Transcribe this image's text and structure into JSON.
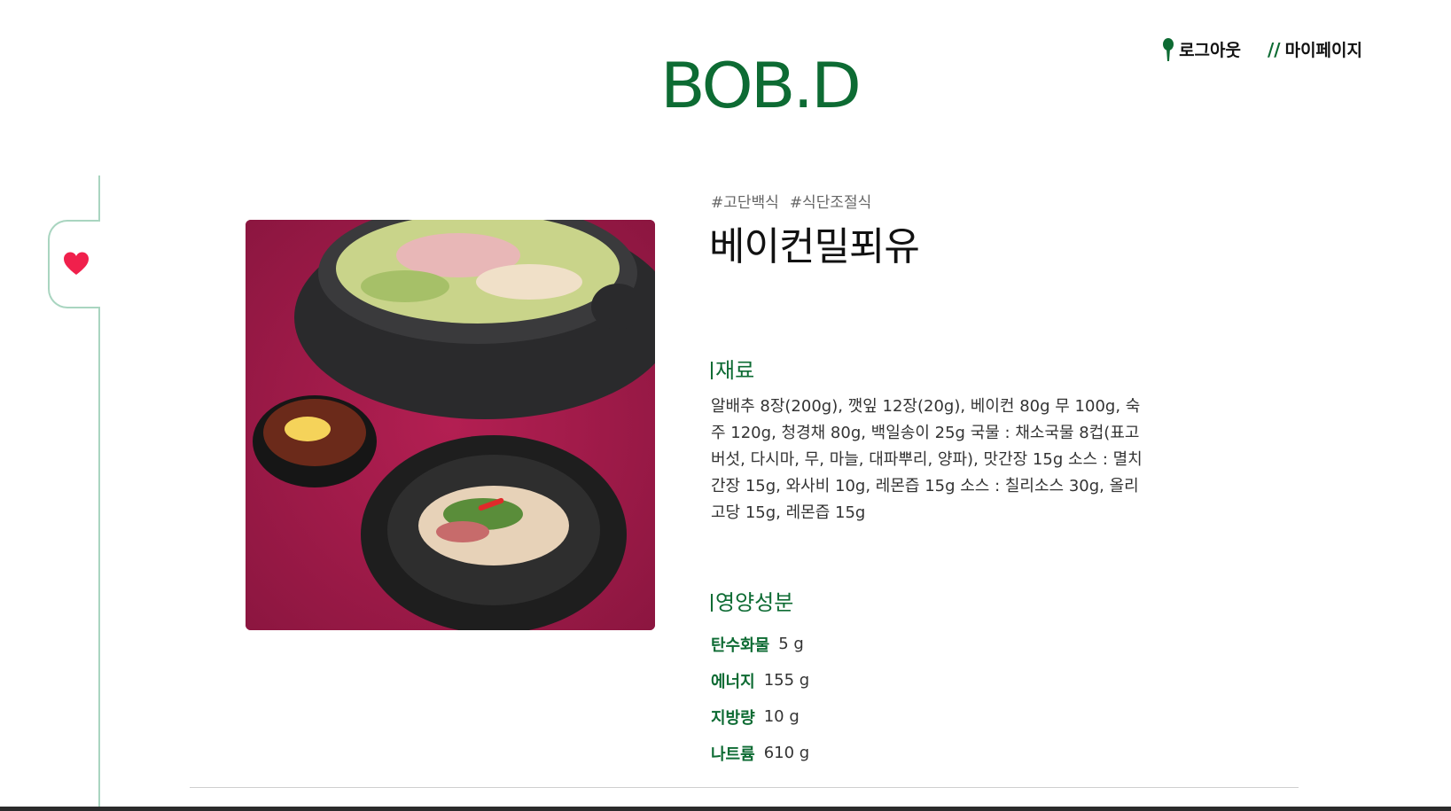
{
  "header": {
    "logo": "BOB.D",
    "nav": [
      {
        "label": "로그아웃",
        "icon": "pin-icon"
      },
      {
        "label": "마이페이지",
        "icon": "double-slash-icon"
      }
    ]
  },
  "sidebar": {
    "favorite_icon": "heart-icon",
    "heart_color": "#f0204c"
  },
  "recipe": {
    "tags": [
      "#고단백식",
      "#식단조절식"
    ],
    "title": "베이컨밀푀유",
    "ingredients_heading": "재료",
    "ingredients": "알배추 8장(200g), 깻잎 12장(20g), 베이컨 80g 무 100g, 숙주 120g, 청경채 80g, 백일송이 25g 국물 : 채소국물 8컵(표고버섯, 다시마, 무, 마늘, 대파뿌리, 양파), 맛간장 15g 소스 : 멸치간장 15g, 와사비 10g, 레몬즙 15g 소스 : 칠리소스 30g, 올리고당 15g, 레몬즙 15g",
    "nutrition_heading": "영양성분",
    "nutrition": [
      {
        "label": "탄수화물",
        "value": "5 g"
      },
      {
        "label": "에너지",
        "value": "155 g"
      },
      {
        "label": "지방량",
        "value": "10 g"
      },
      {
        "label": "나트륨",
        "value": "610 g"
      }
    ]
  },
  "colors": {
    "brand_green": "#0d6b33",
    "accent_line": "#a9d5c0",
    "photo_background": "#a01b48"
  }
}
